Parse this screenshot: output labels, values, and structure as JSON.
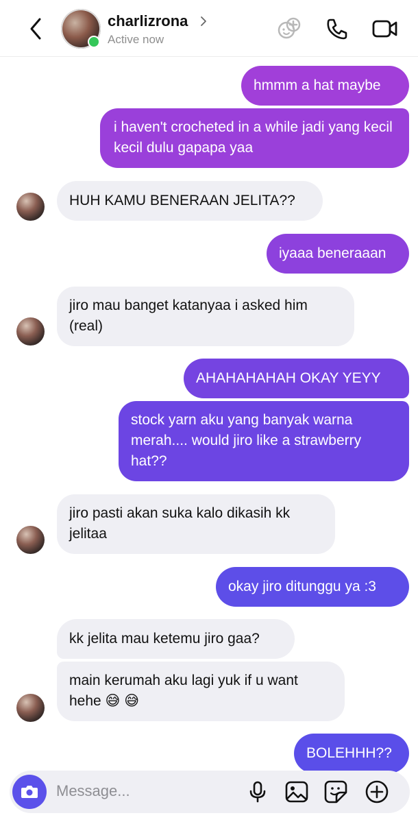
{
  "header": {
    "username": "charlizrona",
    "status": "Active now",
    "icons": [
      "back-icon",
      "games-icon",
      "phone-icon",
      "video-icon",
      "chevron-right-icon"
    ]
  },
  "messages": [
    {
      "side": "sent",
      "text": "hmmm a hat maybe"
    },
    {
      "side": "sent",
      "text": "i haven't crocheted in a while jadi yang kecil kecil dulu gapapa yaa"
    },
    {
      "side": "received",
      "text": "HUH KAMU BENERAAN JELITA??"
    },
    {
      "side": "sent",
      "text": "iyaaa beneraaan"
    },
    {
      "side": "received",
      "text": "jiro mau banget katanyaa i asked him (real)"
    },
    {
      "side": "sent",
      "text": "AHAHAHAHAH OKAY YEYY"
    },
    {
      "side": "sent",
      "text": "stock yarn aku yang banyak warna merah.... would jiro like a strawberry hat??"
    },
    {
      "side": "received",
      "text": "jiro pasti akan suka kalo dikasih kk jelitaa"
    },
    {
      "side": "sent",
      "text": "okay jiro ditunggu ya :3"
    },
    {
      "side": "received",
      "text": "kk jelita mau ketemu jiro gaa?"
    },
    {
      "side": "received",
      "text": "main kerumah aku lagi yuk if u want hehe 😅 😅"
    },
    {
      "side": "sent",
      "text": "BOLEHHH??"
    }
  ],
  "composer": {
    "placeholder": "Message...",
    "icons": [
      "camera-icon",
      "microphone-icon",
      "gallery-icon",
      "sticker-icon",
      "plus-icon"
    ]
  },
  "colors": {
    "sent_top": "#a33fd8",
    "sent_bottom": "#5b4ee8",
    "received": "#efeff4",
    "online": "#34c759"
  }
}
